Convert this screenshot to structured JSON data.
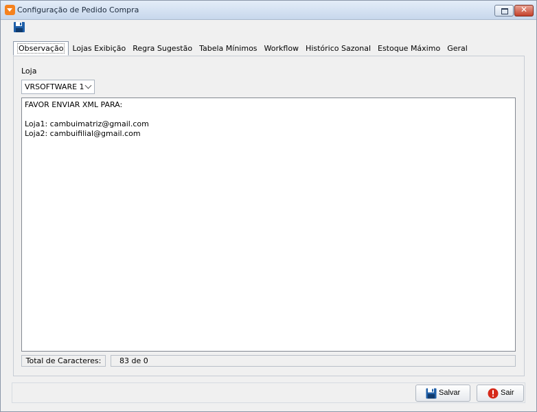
{
  "window": {
    "title": "Configuração de Pedido Compra",
    "close_glyph": "✕"
  },
  "toolbar": {
    "save_icon": "floppy-disk-icon"
  },
  "tabs": [
    {
      "label": "Observação",
      "active": true
    },
    {
      "label": "Lojas Exibição",
      "active": false
    },
    {
      "label": "Regra Sugestão",
      "active": false
    },
    {
      "label": "Tabela Mínimos",
      "active": false
    },
    {
      "label": "Workflow",
      "active": false
    },
    {
      "label": "Histórico Sazonal",
      "active": false
    },
    {
      "label": "Estoque Máximo",
      "active": false
    },
    {
      "label": "Geral",
      "active": false
    }
  ],
  "observacao": {
    "store_label": "Loja",
    "store_selected": "VRSOFTWARE 1",
    "text": "FAVOR ENVIAR XML PARA:\n\nLoja1: cambuimatriz@gmail.com\nLoja2: cambuifilial@gmail.com",
    "char_count_label": "Total de Caracteres:",
    "char_count_value": "83 de 0"
  },
  "footer": {
    "save_label": "Salvar",
    "exit_label": "Sair"
  },
  "colors": {
    "accent_orange": "#f5821f",
    "save_icon_blue": "#1f5fa8",
    "exit_icon_red": "#d62a1a"
  }
}
